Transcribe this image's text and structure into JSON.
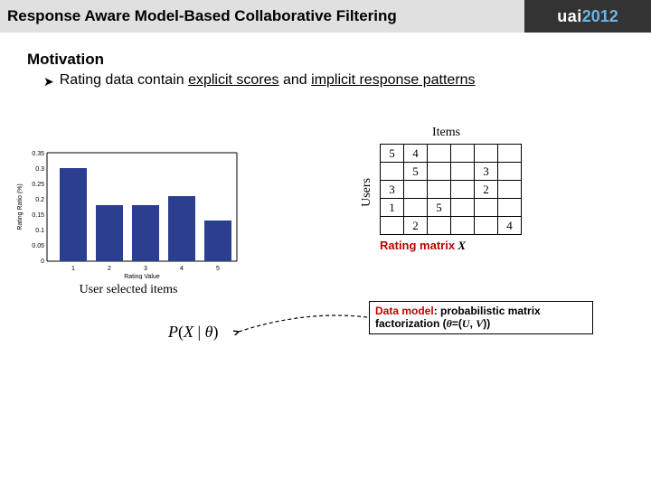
{
  "header": {
    "title": "Response Aware Model-Based Collaborative Filtering",
    "logo_brand": "uai",
    "logo_year": "2012"
  },
  "motivation": {
    "heading": "Motivation",
    "bullet_prefix": "Rating data contain ",
    "bullet_ul1": "explicit scores",
    "bullet_mid": " and ",
    "bullet_ul2": "implicit response patterns"
  },
  "chart_caption": "User selected items",
  "matrix": {
    "items_label": "Items",
    "users_label": "Users",
    "cells": [
      [
        "5",
        "4",
        "",
        "",
        "",
        ""
      ],
      [
        "",
        "5",
        "",
        "",
        "3",
        ""
      ],
      [
        "3",
        "",
        "",
        "",
        "2",
        ""
      ],
      [
        "1",
        "",
        "5",
        "",
        "",
        ""
      ],
      [
        "",
        "2",
        "",
        "",
        "",
        "4"
      ]
    ],
    "caption_red": "Rating matrix",
    "caption_var": " X"
  },
  "data_model": {
    "label": "Data model",
    "text1": ": probabilistic matrix factorization (",
    "theta": "θ",
    "eq": "=(",
    "u": "U",
    "comma": ", ",
    "v": "V",
    "close": "))"
  },
  "formula": {
    "p": "P",
    "open": "(",
    "x": "X",
    "bar": " | ",
    "theta": "θ",
    "close": ")"
  },
  "chart_data": {
    "type": "bar",
    "title": "",
    "xlabel": "Rating Value",
    "ylabel": "Rating Ratio (%)",
    "categories": [
      "1",
      "2",
      "3",
      "4",
      "5"
    ],
    "values": [
      0.3,
      0.18,
      0.18,
      0.21,
      0.13
    ],
    "ylim": [
      0,
      0.35
    ],
    "yticks": [
      0,
      0.05,
      0.1,
      0.15,
      0.2,
      0.25,
      0.3,
      0.35
    ]
  }
}
